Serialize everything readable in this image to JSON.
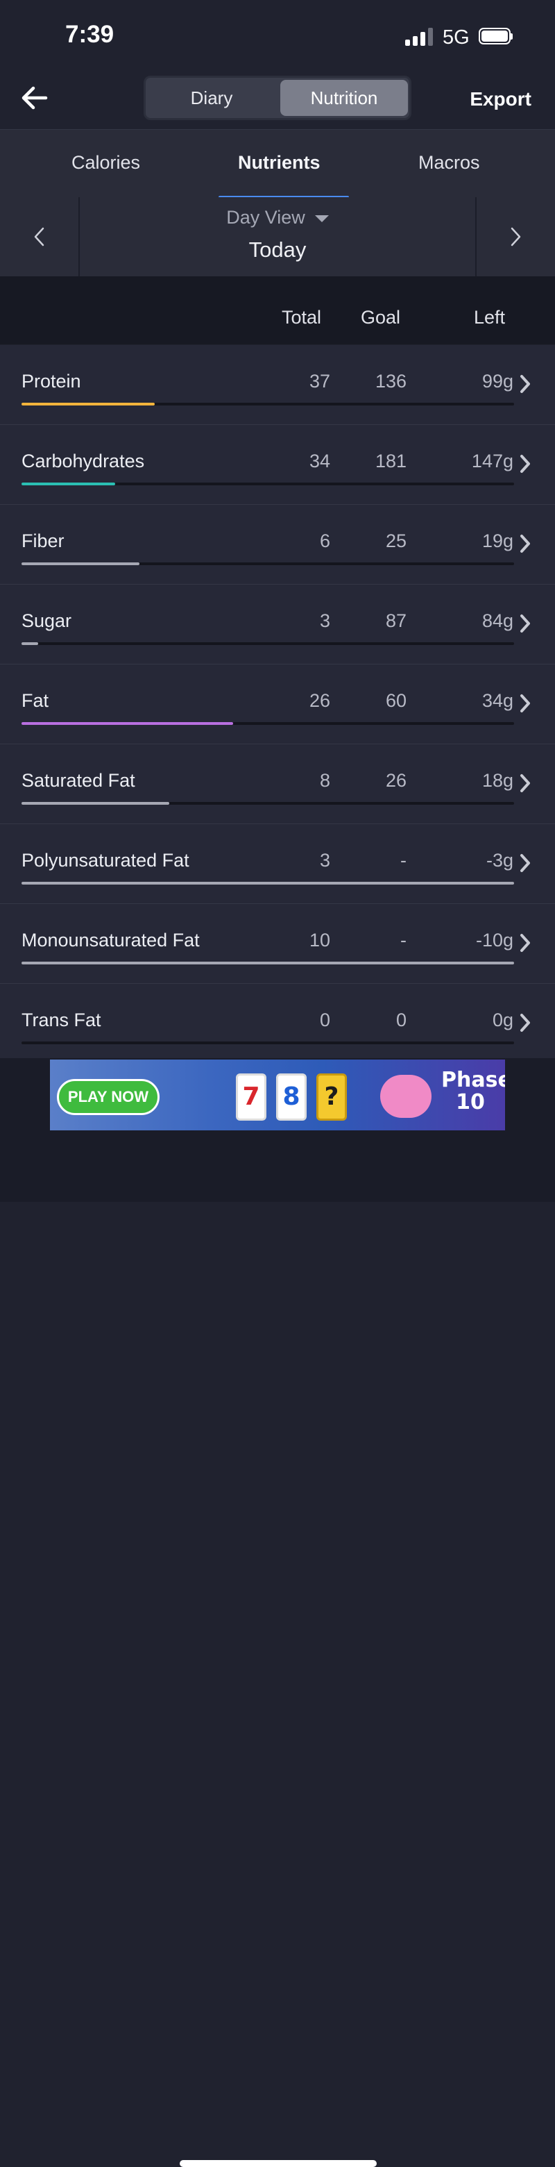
{
  "status_bar": {
    "time": "7:39",
    "network": "5G"
  },
  "navbar": {
    "segments": [
      "Diary",
      "Nutrition"
    ],
    "active_segment": "Nutrition",
    "export_label": "Export"
  },
  "tabs": {
    "items": [
      "Calories",
      "Nutrients",
      "Macros"
    ],
    "active": "Nutrients"
  },
  "date_nav": {
    "view_label": "Day View",
    "date_label": "Today"
  },
  "columns": {
    "total": "Total",
    "goal": "Goal",
    "left": "Left"
  },
  "nutrients": [
    {
      "name": "Protein",
      "total": "37",
      "goal": "136",
      "left": "99g",
      "progress": 0.27,
      "color": "#f2b43c"
    },
    {
      "name": "Carbohydrates",
      "total": "34",
      "goal": "181",
      "left": "147g",
      "progress": 0.19,
      "color": "#2bbfb3"
    },
    {
      "name": "Fiber",
      "total": "6",
      "goal": "25",
      "left": "19g",
      "progress": 0.24,
      "color": "#a6a8b4"
    },
    {
      "name": "Sugar",
      "total": "3",
      "goal": "87",
      "left": "84g",
      "progress": 0.034,
      "color": "#a6a8b4"
    },
    {
      "name": "Fat",
      "total": "26",
      "goal": "60",
      "left": "34g",
      "progress": 0.43,
      "color": "#b96fe0"
    },
    {
      "name": "Saturated Fat",
      "total": "8",
      "goal": "26",
      "left": "18g",
      "progress": 0.3,
      "color": "#a6a8b4"
    },
    {
      "name": "Polyunsaturated Fat",
      "total": "3",
      "goal": "-",
      "left": "-3g",
      "progress": 1.0,
      "color": "#a6a8b4"
    },
    {
      "name": "Monounsaturated Fat",
      "total": "10",
      "goal": "-",
      "left": "-10g",
      "progress": 1.0,
      "color": "#a6a8b4"
    },
    {
      "name": "Trans Fat",
      "total": "0",
      "goal": "0",
      "left": "0g",
      "progress": 0.0,
      "color": "#a6a8b4"
    }
  ],
  "ad": {
    "cta": "PLAY NOW",
    "card_1": "7",
    "card_2": "8",
    "card_3": "?",
    "logo": "Phase 10"
  }
}
